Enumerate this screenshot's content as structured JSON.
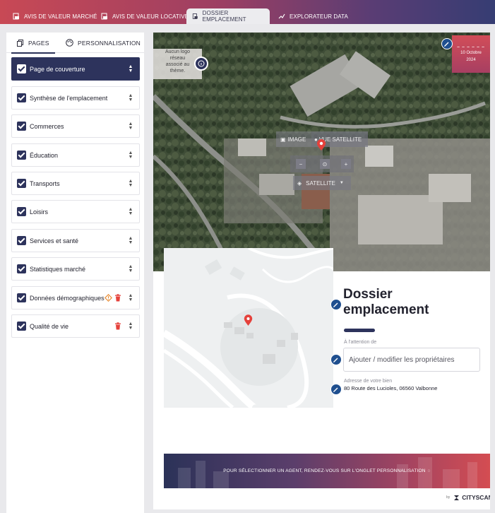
{
  "top_tabs": [
    {
      "label": "AVIS DE VALEUR MARCHÉ",
      "icon": "report-icon"
    },
    {
      "label": "AVIS DE VALEUR LOCATIVE",
      "icon": "report-icon"
    },
    {
      "label": "DOSSIER EMPLACEMENT",
      "icon": "document-icon"
    },
    {
      "label": "EXPLORATEUR DATA",
      "icon": "chart-line-icon"
    }
  ],
  "panel_tabs": {
    "pages": "PAGES",
    "personnalisation": "PERSONNALISATION"
  },
  "pages": [
    {
      "label": "Page de couverture",
      "checked": true
    },
    {
      "label": "Synthèse de l'emplacement",
      "checked": true
    },
    {
      "label": "Commerces",
      "checked": true
    },
    {
      "label": "Éducation",
      "checked": true
    },
    {
      "label": "Transports",
      "checked": true
    },
    {
      "label": "Loisirs",
      "checked": true
    },
    {
      "label": "Services et santé",
      "checked": true
    },
    {
      "label": "Statistiques marché",
      "checked": true
    },
    {
      "label": "Données démographiques",
      "checked": true
    },
    {
      "label": "Qualité de vie",
      "checked": true
    }
  ],
  "cover": {
    "logo_note_l1": "Aucun logo",
    "logo_note_l2": "réseau",
    "logo_note_l3": "associé au",
    "logo_note_l4": "thème.",
    "date_line1": "10 Octobre",
    "date_line2": "2024",
    "map_image_label": "IMAGE",
    "map_satellite_label": "VUE SATELLITE",
    "map_layer_label": "SATELLITE",
    "title": "Dossier\nemplacement",
    "attention_label": "À l'attention de",
    "attention_placeholder": "Ajouter / modifier les propriétaires",
    "address_label": "Adresse de votre bien",
    "address_value": "80 Route des Lucioles, 06560 Valbonne",
    "banner_text": "POUR SÉLECTIONNER UN AGENT, RENDEZ-VOUS SUR L'ONGLET PERSONNALISATION",
    "brand_by": "by",
    "brand_name": "CITYSCAN"
  },
  "colors": {
    "accent": "#2d335c",
    "danger": "#e5413b",
    "warning": "#e8882c",
    "edit": "#1f4f8f"
  }
}
